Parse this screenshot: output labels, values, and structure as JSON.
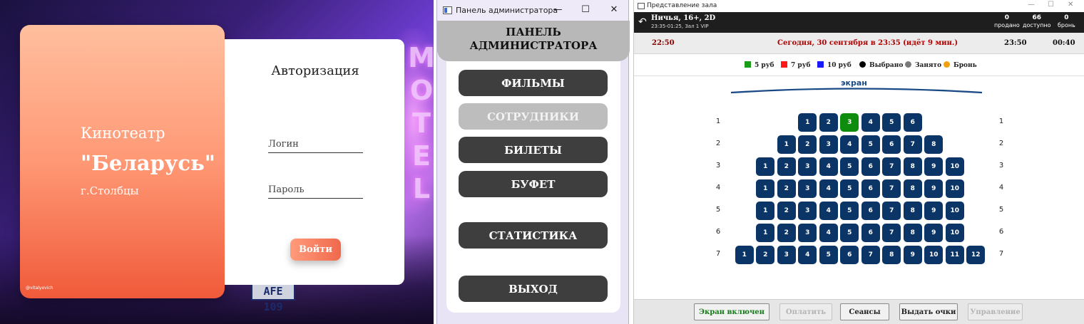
{
  "login": {
    "cinema_label": "Кинотеатр",
    "cinema_name": "\"Беларусь\"",
    "city": "г.Столбцы",
    "credit": "@vitalyevich",
    "auth_title": "Авторизация",
    "login_placeholder": "Логин",
    "password_placeholder": "Пароль",
    "submit_label": "Войти",
    "background_sign": "MOTEL",
    "plate_text": "AFE 109"
  },
  "admin": {
    "window_title": "Панель администратора",
    "header_line1": "ПАНЕЛЬ",
    "header_line2": "АДМИНИСТРАТОРА",
    "buttons": [
      {
        "label": "ФИЛЬМЫ",
        "disabled": false
      },
      {
        "label": "СОТРУДНИКИ",
        "disabled": true
      },
      {
        "label": "БИЛЕТЫ",
        "disabled": false
      },
      {
        "label": "БУФЕТ",
        "disabled": false
      },
      {
        "label": "СТАТИСТИКА",
        "disabled": false
      },
      {
        "label": "ВЫХОД",
        "disabled": false
      }
    ]
  },
  "hall": {
    "window_title": "Представление зала",
    "movie_title": "Ничья, 16+, 2D",
    "movie_sub": "23:35-01:25, Зал 1 VIP",
    "stats": {
      "sold_n": "0",
      "sold_l": "продано",
      "avail_n": "66",
      "avail_l": "доступно",
      "booked_n": "0",
      "booked_l": "бронь"
    },
    "timeline": {
      "start": "22:50",
      "current": "Сегодня, 30 сентября в 23:35 (идёт 9 мин.)",
      "mid": "23:50",
      "end": "00:40"
    },
    "legend": [
      {
        "label": "5 руб",
        "color": "#1a9c1a",
        "shape": "square"
      },
      {
        "label": "7 руб",
        "color": "#ff1a1a",
        "shape": "square"
      },
      {
        "label": "10 руб",
        "color": "#1a1aff",
        "shape": "square"
      },
      {
        "label": "Выбрано",
        "color": "#000000",
        "shape": "circle"
      },
      {
        "label": "Занято",
        "color": "#7a7a7a",
        "shape": "circle"
      },
      {
        "label": "Бронь",
        "color": "#f0a20a",
        "shape": "circle"
      }
    ],
    "screen_label": "экран",
    "rows": [
      {
        "row": "1",
        "seats": 6,
        "selected": [
          3
        ]
      },
      {
        "row": "2",
        "seats": 8,
        "selected": []
      },
      {
        "row": "3",
        "seats": 10,
        "selected": []
      },
      {
        "row": "4",
        "seats": 10,
        "selected": []
      },
      {
        "row": "5",
        "seats": 10,
        "selected": []
      },
      {
        "row": "6",
        "seats": 10,
        "selected": []
      },
      {
        "row": "7",
        "seats": 12,
        "selected": []
      }
    ],
    "seat_color": "#0b3566",
    "seat_selected_color": "#0e8c0e",
    "buttons": [
      {
        "label": "Экран включен",
        "style": "green"
      },
      {
        "label": "Оплатить",
        "style": "disabled"
      },
      {
        "label": "Сеансы",
        "style": "normal"
      },
      {
        "label": "Выдать очки",
        "style": "normal"
      },
      {
        "label": "Управление",
        "style": "disabled"
      }
    ]
  }
}
